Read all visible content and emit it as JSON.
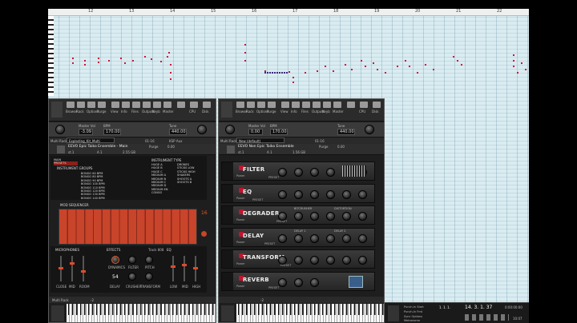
{
  "piano_roll": {
    "bar_numbers": [
      "12",
      "13",
      "14",
      "15",
      "16",
      "17",
      "18",
      "19",
      "20",
      "21",
      "22"
    ]
  },
  "kontakt_left": {
    "toolbar": [
      "Browse",
      "Rack",
      "Options",
      "Purge",
      "View",
      "Info",
      "Files",
      "Outputs",
      "Keyb",
      "Master",
      "",
      "CPU",
      "Disk"
    ],
    "master": {
      "vol_label": "Master Vol",
      "vol": "-3.09",
      "bpm_label": "BPM",
      "bpm": "170.00",
      "tune_label": "Tune",
      "tune": "440.00"
    },
    "multi": {
      "label": "Multi Rack",
      "name": "Exploding_Kit_Multi",
      "slots": "01-16",
      "tabs": "KSP  Aux"
    },
    "instrument": {
      "title": "EEVO Epic Taiko Ensemble - Main",
      "output": "st.1",
      "midi_ch": "A 1",
      "voices": "0",
      "max": "64",
      "memory": "2.55 GB",
      "tune": "0.00",
      "purge": "Purge"
    },
    "menu": {
      "items": [
        "MAIN",
        "PRESETS"
      ],
      "groups_header": "INSTRUMENT GROUPS",
      "type_header": "INSTRUMENT TYPE"
    },
    "groups": [
      "BONGO 60 BPM",
      "BONGO 80 BPM",
      "BONGO 90 BPM",
      "BONGO 100 BPM",
      "BONGO 110 BPM",
      "BONGO 120 BPM",
      "BONGO 130 BPM",
      "BONGO 140 BPM"
    ],
    "types_a": [
      "HUGE A",
      "HUGE B",
      "HUGE C",
      "MEDIUM A",
      "MEDIUM B",
      "MEDIUM C",
      "MEDIUM D",
      "MEDIUM EN",
      "CONGO"
    ],
    "types_b": [
      "DRONES",
      "STICKS LOW",
      "STICKS HIGH",
      "SHAKERS",
      "SHOOTS A",
      "SHOOTS B",
      "",
      "",
      ""
    ],
    "seq": {
      "title": "MOD SEQUENCER",
      "steps": "16"
    },
    "mics": {
      "title": "MICROPHONES",
      "close": "CLOSE",
      "mid": "MID",
      "room": "ROOM"
    },
    "effects": {
      "title": "EFFECTS",
      "tr808": "Track 808",
      "dynamics": "DYNAMICS",
      "filter": "FILTER",
      "pitch": "PITCH",
      "delay": "DELAY",
      "crusher": "CRUSHER",
      "transform": "TRANSFORM",
      "value": "54"
    },
    "eq": {
      "title": "EQ",
      "low": "LOW",
      "mid": "MID",
      "high": "HIGH"
    },
    "keyboard": {
      "label": "Multi Rack",
      "oct": "-2"
    }
  },
  "kontakt_right": {
    "toolbar": [
      "Browse",
      "Rack",
      "Options",
      "Purge",
      "View",
      "Info",
      "Files",
      "Outputs",
      "Keyb",
      "Master",
      "",
      "CPU",
      "Disk"
    ],
    "master": {
      "vol_label": "Master Vol",
      "vol": "0.00",
      "bpm_label": "BPM",
      "bpm": "170.00",
      "tune_label": "Tune",
      "tune": "440.00"
    },
    "multi": {
      "label": "Multi Rack",
      "name": "New (default)",
      "slots": "01-16"
    },
    "instrument": {
      "title": "EEVO Non Epic Taiko Ensemble",
      "output": "st.1",
      "midi_ch": "A 1",
      "voices": "0",
      "max": "64",
      "memory": "1.56 GB",
      "tune": "0.00",
      "purge": "Purge"
    },
    "fx": [
      {
        "name": "FILTER",
        "power": "Power",
        "preset": "PRESET"
      },
      {
        "name": "EQ",
        "power": "Power",
        "preset": "PRESET"
      },
      {
        "name": "DEGRADER",
        "power": "Power",
        "preset": "PRESET",
        "sec1": "BITCRUSHER",
        "sec2": "DISTORTION"
      },
      {
        "name": "DELAY",
        "power": "Power",
        "preset": "PRESET",
        "sec1": "DELAY 1",
        "sec2": "DELAY 2"
      },
      {
        "name": "TRANSFORM",
        "power": "Power",
        "preset": "PRESET"
      },
      {
        "name": "REVERB",
        "power": "Power",
        "preset": "PRESET"
      }
    ],
    "keyboard": {
      "oct": "-2"
    }
  },
  "transport": {
    "position1": "1. 1. 1.",
    "position2": "14. 3. 1. 37",
    "time": "0:00:00:00",
    "labels": [
      "Punch-In Start",
      "Punch-In Fmt",
      "Sync Options",
      "Metronome"
    ],
    "status": "10:07"
  },
  "colors": {
    "note": "#d0123f",
    "rack_red": "#c0152e",
    "seq_orange": "#c8442a"
  }
}
